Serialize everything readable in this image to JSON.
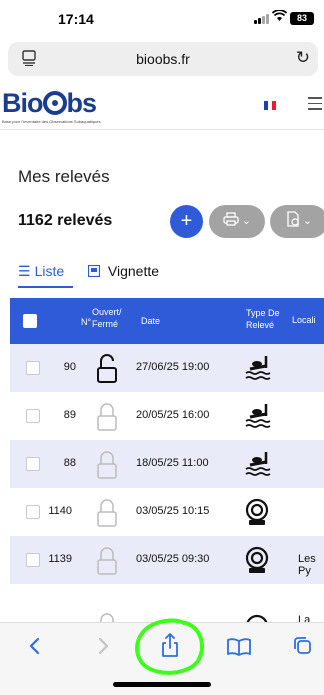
{
  "status_bar": {
    "time": "17:14",
    "battery": "83",
    "wifi_icon": "wifi-icon",
    "signal_icon": "signal-icon"
  },
  "browser": {
    "url": "bioobs.fr",
    "tab_icon": "tabs-icon",
    "reload_icon": "reload-icon"
  },
  "site_header": {
    "logo_text_before": "Bio",
    "logo_text_after": "bs",
    "logo_subtitle": "Base pour l'Inventaire des Observations Subaquatiques",
    "flag_colors": [
      "#1f3fae",
      "#ffffff",
      "#e0202f"
    ],
    "menu_icon": "hamburger-icon"
  },
  "page": {
    "title": "Mes relevés",
    "count_text": "1162 relevés"
  },
  "actions": {
    "add_label": "+",
    "print_icon": "printer-icon",
    "export_icon": "export-icon",
    "dropdown_glyph": "⌄"
  },
  "view_tabs": [
    {
      "label": "Liste",
      "icon": "list-icon",
      "active": true
    },
    {
      "label": "Vignette",
      "icon": "grid-icon",
      "active": false
    }
  ],
  "table": {
    "headers": {
      "num": "N°",
      "open_closed_1": "Ouvert/",
      "open_closed_2": "Fermé",
      "date": "Date",
      "type_1": "Type De",
      "type_2": "Relevé",
      "location": "Locali"
    },
    "rows": [
      {
        "num": "90",
        "lock": "open",
        "date": "27/06/25 19:00",
        "type": "snorkel",
        "location": ""
      },
      {
        "num": "89",
        "lock": "closed",
        "date": "20/05/25 16:00",
        "type": "snorkel",
        "location": ""
      },
      {
        "num": "88",
        "lock": "closed",
        "date": "18/05/25 11:00",
        "type": "snorkel",
        "location": ""
      },
      {
        "num": "1140",
        "lock": "closed",
        "date": "03/05/25 10:15",
        "type": "diving-helmet",
        "location": ""
      },
      {
        "num": "1139",
        "lock": "closed",
        "date": "03/05/25 09:30",
        "type": "diving-helmet",
        "location": "Les Py"
      },
      {
        "num": "",
        "lock": "closed",
        "date": "",
        "type": "diving-helmet",
        "location": "La Lis"
      }
    ]
  },
  "toolbar": {
    "back_icon": "back-icon",
    "forward_icon": "forward-icon",
    "share_icon": "share-icon",
    "bookmarks_icon": "bookmarks-icon",
    "tabs_icon": "tabs-overview-icon"
  },
  "colors": {
    "primary": "#2f5bd8",
    "logo": "#1a3e8c",
    "gray_button": "#a3a3a3",
    "row_alt": "#e9ecf8",
    "circle_mark": "#3dff1a"
  }
}
